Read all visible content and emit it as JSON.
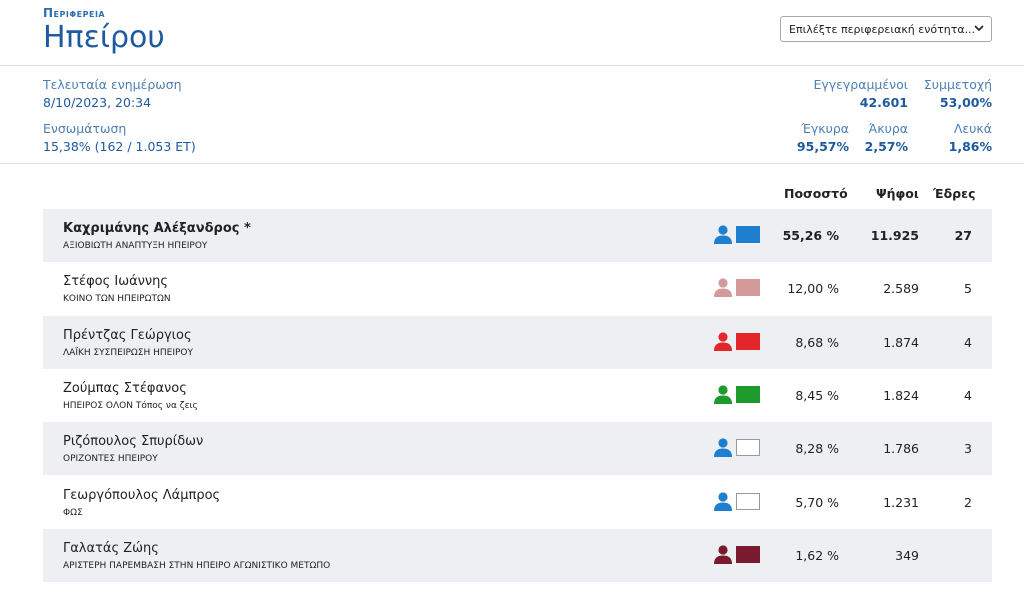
{
  "header": {
    "region_label": "Περιφερεια",
    "region_name": "Ηπείρου",
    "select_placeholder": "Επιλέξτε περιφερειακή ενότητα..."
  },
  "meta": {
    "last_update_label": "Τελευταία ενημέρωση",
    "last_update_value": "8/10/2023, 20:34",
    "integration_label": "Ενσωμάτωση",
    "integration_value": "15,38% (162 / 1.053 ΕΤ)",
    "registered_label": "Εγγεγραμμένοι",
    "registered_value": "42.601",
    "turnout_label": "Συμμετοχή",
    "turnout_value": "53,00%",
    "valid_label": "Έγκυρα",
    "valid_value": "95,57%",
    "invalid_label": "Άκυρα",
    "invalid_value": "2,57%",
    "blank_label": "Λευκά",
    "blank_value": "1,86%"
  },
  "table": {
    "headers": {
      "percent": "Ποσοστό",
      "votes": "Ψήφοι",
      "seats": "Έδρες"
    },
    "rows": [
      {
        "name": "Καχριμάνης Αλέξανδρος *",
        "party": "ΑΞΙΟΒΙΩΤΗ ΑΝΑΠΤΥΞΗ ΗΠΕΙΡΟΥ",
        "percent": "55,26 %",
        "votes": "11.925",
        "seats": "27",
        "color": "#1e7fcf"
      },
      {
        "name": "Στέφος Ιωάννης",
        "party": "ΚΟΙΝΟ ΤΩΝ ΗΠΕΙΡΩΤΩΝ",
        "percent": "12,00 %",
        "votes": "2.589",
        "seats": "5",
        "color": "#d49a9a"
      },
      {
        "name": "Πρέντζας Γεώργιος",
        "party": "ΛΑΪΚΗ ΣΥΣΠΕΙΡΩΣΗ ΗΠΕΙΡΟΥ",
        "percent": "8,68 %",
        "votes": "1.874",
        "seats": "4",
        "color": "#e3262b"
      },
      {
        "name": "Ζούμπας Στέφανος",
        "party": "ΗΠΕΙΡΟΣ ΟΛΟΝ Τόπος να ζεις",
        "percent": "8,45 %",
        "votes": "1.824",
        "seats": "4",
        "color": "#1c9a2b"
      },
      {
        "name": "Ριζόπουλος Σπυρίδων",
        "party": "ΟΡΙΖΟΝΤΕΣ ΗΠΕΙΡΟΥ",
        "percent": "8,28 %",
        "votes": "1.786",
        "seats": "3",
        "color": "#1e7fcf",
        "swatch": "#ffffff"
      },
      {
        "name": "Γεωργόπουλος Λάμπρος",
        "party": "ΦΩΣ",
        "percent": "5,70 %",
        "votes": "1.231",
        "seats": "2",
        "color": "#1e7fcf",
        "swatch": "#ffffff"
      },
      {
        "name": "Γαλατάς Ζώης",
        "party": "ΑΡΙΣΤΕΡΗ ΠΑΡΕΜΒΑΣΗ ΣΤΗΝ ΗΠΕΙΡΟ ΑΓΩΝΙΣΤΙΚΟ ΜΕΤΩΠΟ",
        "percent": "1,62 %",
        "votes": "349",
        "seats": "",
        "color": "#7a1a2e"
      }
    ]
  },
  "icons": {
    "person": "person-icon",
    "chevron": "chevron-down-icon"
  }
}
